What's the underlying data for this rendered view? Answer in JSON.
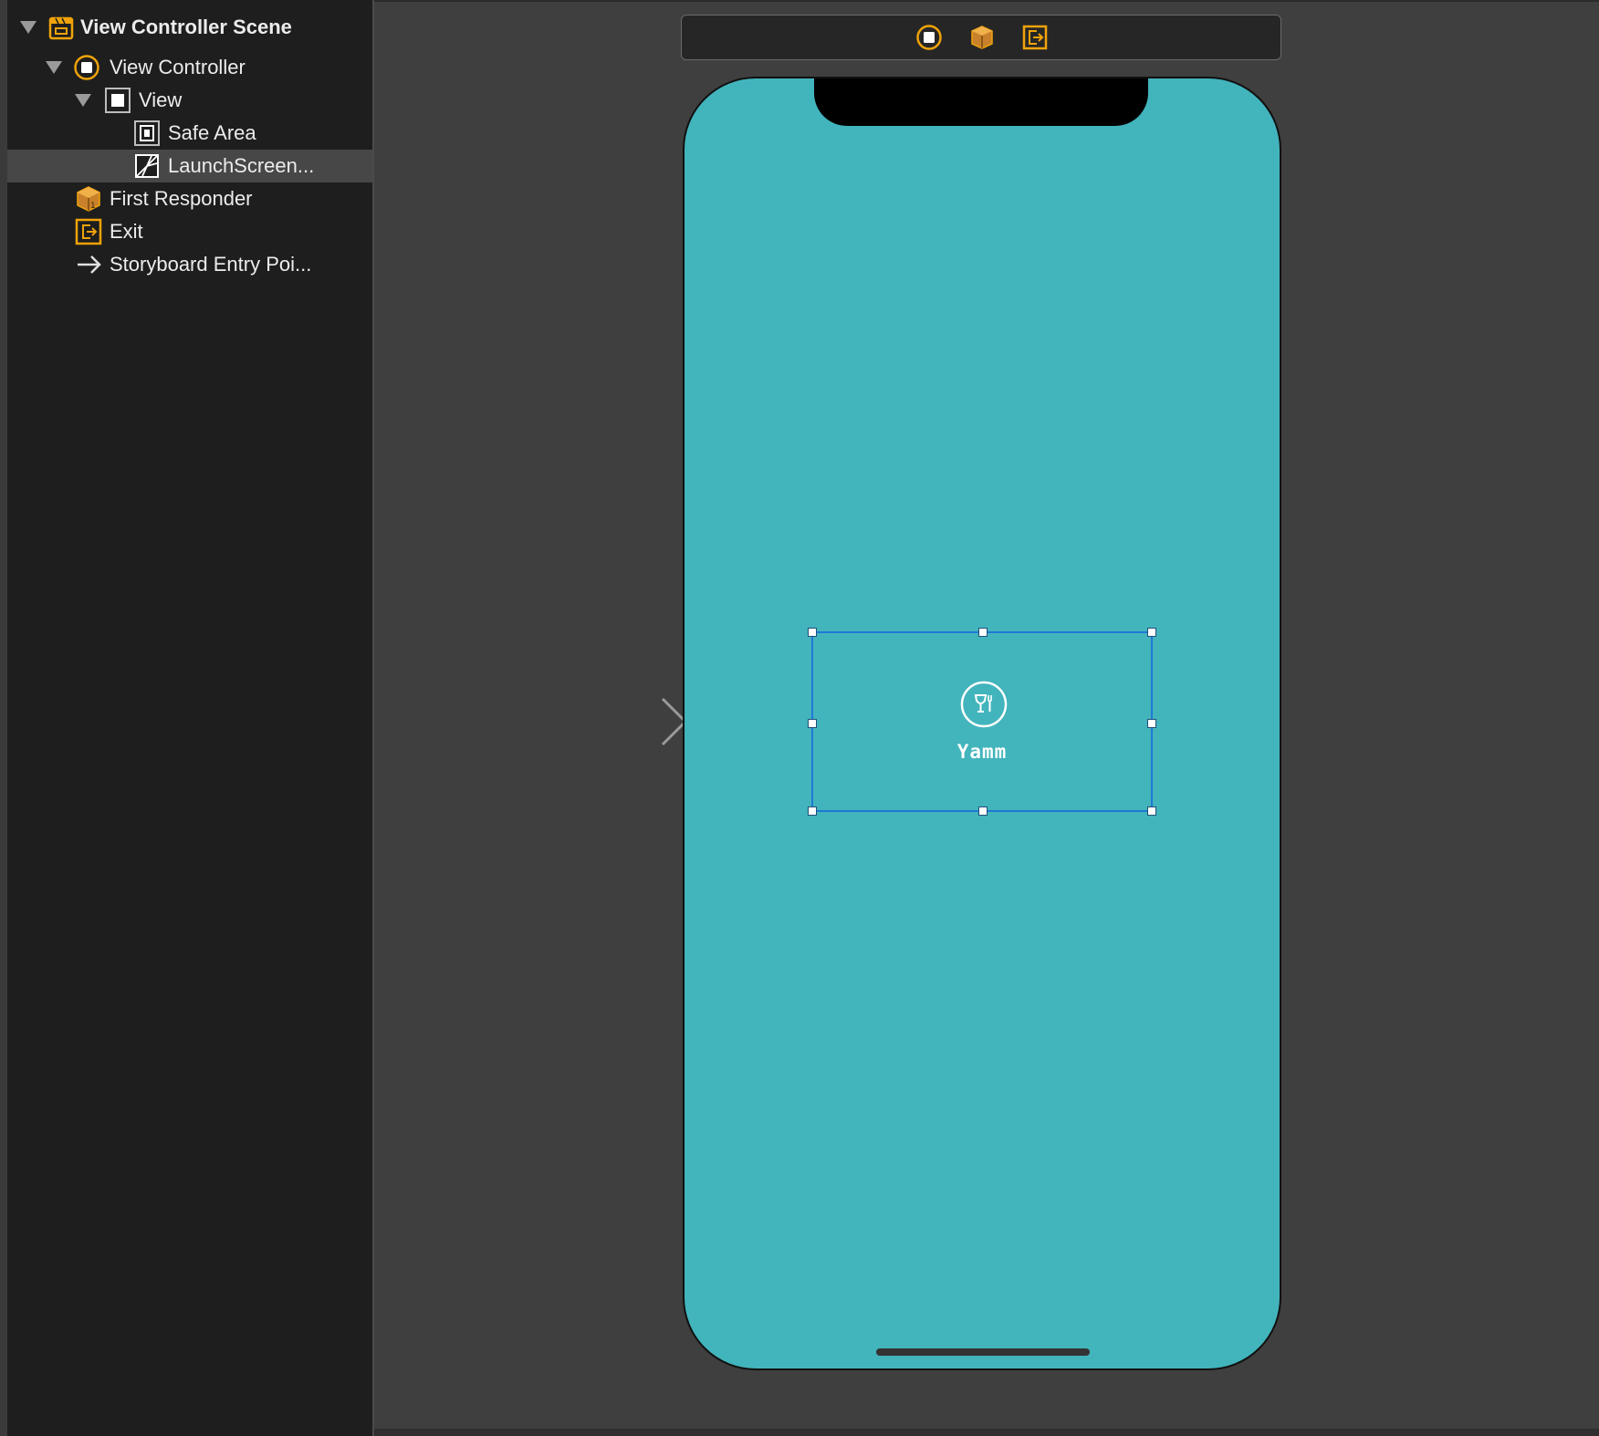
{
  "outline": {
    "items": [
      {
        "label": "View Controller Scene",
        "icon": "scene-icon",
        "bold": true,
        "disclosure": "expanded"
      },
      {
        "label": "View Controller",
        "icon": "view-controller-icon",
        "disclosure": "expanded"
      },
      {
        "label": "View",
        "icon": "view-icon",
        "disclosure": "expanded"
      },
      {
        "label": "Safe Area",
        "icon": "safe-area-icon"
      },
      {
        "label": "LaunchScreen...",
        "icon": "image-view-icon",
        "selected": true
      },
      {
        "label": "First Responder",
        "icon": "first-responder-icon"
      },
      {
        "label": "Exit",
        "icon": "exit-icon"
      },
      {
        "label": "Storyboard Entry Poi...",
        "icon": "arrow-right-icon"
      }
    ]
  },
  "canvas": {
    "scene_dock_icons": [
      "view-controller-icon",
      "first-responder-icon",
      "exit-icon"
    ],
    "entry_point": "storyboard-entry-arrow",
    "device": {
      "background_color": "#42b4bc",
      "launch_image": {
        "logo_icon": "wine-glass-fork-icon",
        "brand_name": "Yamm",
        "selection_color": "#1f79d6"
      }
    }
  },
  "colors": {
    "outline_bg": "#1e1e1e",
    "canvas_bg": "#3f3f3f",
    "selected_row": "#474747",
    "accent_orange": "#f0a30a"
  }
}
